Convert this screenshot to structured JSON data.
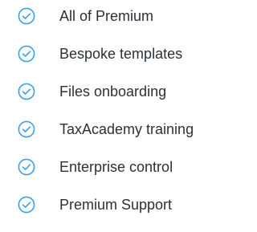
{
  "features": {
    "items": [
      {
        "label": "All of Premium",
        "icon": "check-circle-icon"
      },
      {
        "label": "Bespoke templates",
        "icon": "check-circle-icon"
      },
      {
        "label": "Files onboarding",
        "icon": "check-circle-icon"
      },
      {
        "label": "TaxAcademy training",
        "icon": "check-circle-icon"
      },
      {
        "label": "Enterprise control",
        "icon": "check-circle-icon"
      },
      {
        "label": "Premium Support",
        "icon": "check-circle-icon"
      }
    ]
  },
  "colors": {
    "icon": "#3aa0e6",
    "text": "#2b3138",
    "background": "#ffffff"
  }
}
